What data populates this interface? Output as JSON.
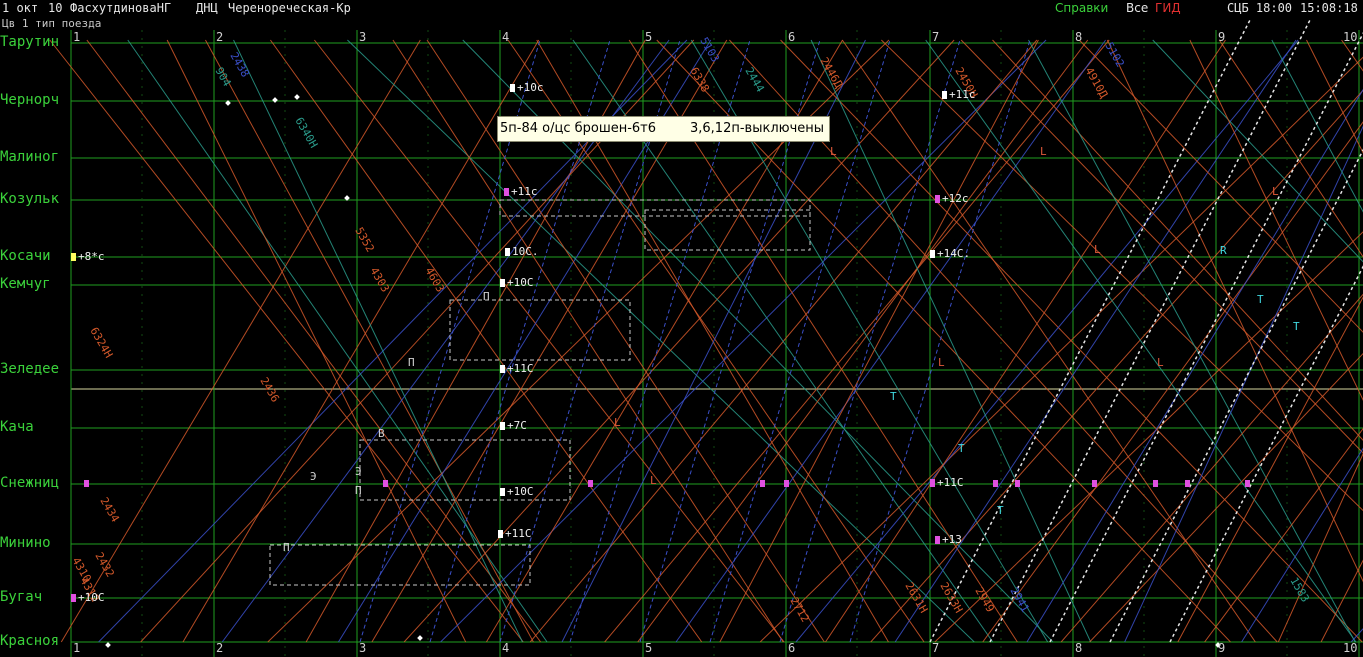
{
  "header": {
    "date": "1 окт",
    "shift": "10",
    "operator": "ФасхутдиноваНГ",
    "dispatcher": "ДНЦ",
    "section": "Черенореческая-Кр",
    "menu_help": "Справки",
    "menu_all": "Все",
    "menu_gid": "ГИД",
    "time_label": "СЦБ 18:00",
    "clock": "15:08:18"
  },
  "subheader": "Цв 1 тип поезда",
  "stations": [
    "Тарутин",
    "Чернорч",
    "Малиног",
    "Козульк",
    "Косачи",
    "Кемчуг",
    "Зеледее",
    "Кача",
    "Снежниц",
    "Минино",
    "Бугач",
    "Красноя"
  ],
  "hours": [
    "1",
    "2",
    "3",
    "4",
    "5",
    "6",
    "7",
    "8",
    "9",
    "10"
  ],
  "annotations": [
    {
      "text": "+10с",
      "style": "w"
    },
    {
      "text": "+11с",
      "style": "w"
    },
    {
      "text": "+11с",
      "style": "m"
    },
    {
      "text": "+12с",
      "style": "m"
    },
    {
      "text": "+8*с",
      "style": "y"
    },
    {
      "text": "10С.",
      "style": "w"
    },
    {
      "text": "+14С.",
      "style": "w"
    },
    {
      "text": "+10С",
      "style": "w"
    },
    {
      "text": "+11С",
      "style": "w"
    },
    {
      "text": "+7С",
      "style": "w"
    },
    {
      "text": "+10С",
      "style": "w"
    },
    {
      "text": "+11С",
      "style": "m"
    },
    {
      "text": "+11С",
      "style": "w"
    },
    {
      "text": "+13",
      "style": "m"
    },
    {
      "text": "+10С",
      "style": "m"
    }
  ],
  "tooltip": {
    "left": "5п-84 о/цс брошен-6т6",
    "right": "3,6,12п-выключены"
  },
  "train_labels": [
    "2434",
    "4310",
    "2432",
    "5103",
    "2444",
    "6338",
    "2446Д",
    "2450Н",
    "4910Д",
    "5102",
    "6340Н",
    "5352",
    "4303",
    "4603",
    "2436",
    "2438",
    "904",
    "6324Н",
    "2631Н",
    "2633Н",
    "2949",
    "2941",
    "1583",
    "4312",
    "2712"
  ],
  "marker_letters": [
    "L",
    "L",
    "L",
    "L",
    "L",
    "L",
    "L",
    "L",
    "Т",
    "Т",
    "Т",
    "Т",
    "Т",
    "R",
    "В",
    "П",
    "П",
    "П",
    "Э",
    "Э",
    "П"
  ],
  "colors": {
    "background": "#000000",
    "grid": "#1f9e1f",
    "station_text": "#3bd23b",
    "train_orange": "#d2582a",
    "train_blue": "#3a4fc8",
    "train_white": "#e6e6e6",
    "train_teal": "#2a9a8a",
    "train_magenta": "#c040c0"
  }
}
